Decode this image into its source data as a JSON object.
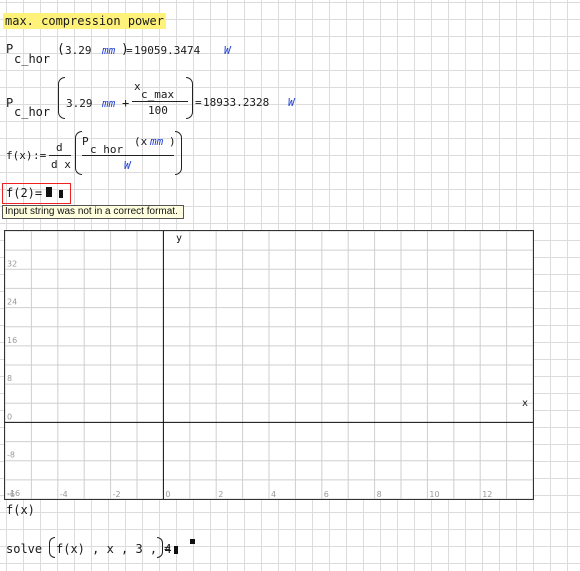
{
  "title": "max. compression power",
  "eq1": {
    "lhs_main": "P",
    "lhs_sub": "c_hor",
    "arg_num": "3.29",
    "arg_unit": "mm",
    "eq": "=",
    "result": "19059.3474",
    "result_unit": "W"
  },
  "eq2": {
    "lhs_main": "P",
    "lhs_sub": "c_hor",
    "arg_num": "3.29",
    "arg_unit": "mm",
    "plus": "+",
    "frac_num_main": "x",
    "frac_num_sub": "c_max",
    "frac_den": "100",
    "eq": "=",
    "result": "18933.2328",
    "result_unit": "W"
  },
  "eq3": {
    "lhs": "f(x)",
    "assign": ":=",
    "d_num": "d",
    "d_den": "d x",
    "inner_main": "P",
    "inner_sub": "c hor",
    "inner_arg": "(x",
    "inner_arg_unit": "mm",
    "inner_arg_close": ")",
    "den_unit": "W"
  },
  "eq4": {
    "expr": "f(2)=",
    "error_message": "Input string was not in a correct format."
  },
  "plot": {
    "x_axis_label": "x",
    "y_axis_label": "y",
    "y_ticks": [
      "32",
      "24",
      "16",
      "8",
      "0",
      "-8",
      "-16"
    ],
    "x_ticks": [
      "-6",
      "-4",
      "-2",
      "0",
      "2",
      "4",
      "6",
      "8",
      "10",
      "12"
    ],
    "x_range": [
      -6,
      14
    ],
    "y_range": [
      -16,
      40
    ],
    "function_label": "f(x)"
  },
  "eq5": {
    "expr_start": "solve",
    "expr_args": "f(x) , x , 3 , 4",
    "eq": "="
  }
}
